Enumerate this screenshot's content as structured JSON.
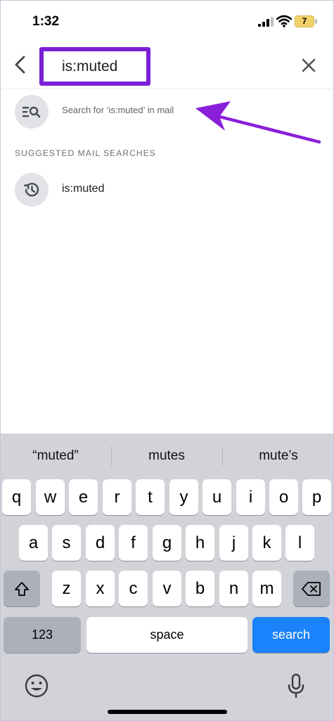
{
  "status_bar": {
    "time": "1:32",
    "battery_level": "7"
  },
  "search": {
    "query": "is:muted"
  },
  "suggestions": {
    "search_for_text": "Search for ‘is:muted’ in mail",
    "section_label": "SUGGESTED MAIL SEARCHES",
    "recent_query": "is:muted"
  },
  "keyboard": {
    "predictions": [
      "“muted”",
      "mutes",
      "mute’s"
    ],
    "row1": [
      "q",
      "w",
      "e",
      "r",
      "t",
      "y",
      "u",
      "i",
      "o",
      "p"
    ],
    "row2": [
      "a",
      "s",
      "d",
      "f",
      "g",
      "h",
      "j",
      "k",
      "l"
    ],
    "row3": [
      "z",
      "x",
      "c",
      "v",
      "b",
      "n",
      "m"
    ],
    "numbers_label": "123",
    "space_label": "space",
    "search_label": "search"
  },
  "colors": {
    "highlight": "#7a1fd6",
    "arrow": "#8a1fd9",
    "search_key": "#1a82fb"
  }
}
